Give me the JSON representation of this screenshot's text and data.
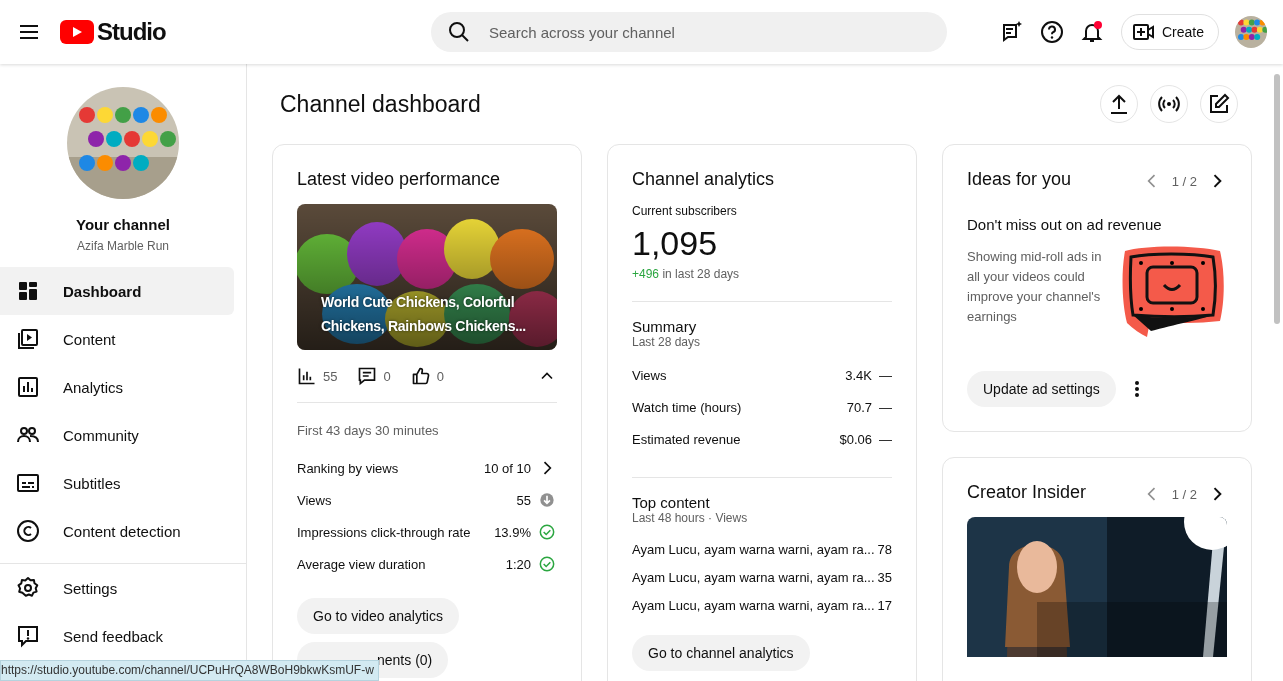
{
  "header": {
    "logo_text": "Studio",
    "search": {
      "placeholder": "Search across your channel"
    },
    "notifications_unread": true,
    "create_label": "Create"
  },
  "sidebar": {
    "channel_title": "Your channel",
    "channel_name": "Azifa Marble Run",
    "items": [
      {
        "label": "Dashboard",
        "selected": true
      },
      {
        "label": "Content",
        "selected": false
      },
      {
        "label": "Analytics",
        "selected": false
      },
      {
        "label": "Community",
        "selected": false
      },
      {
        "label": "Subtitles",
        "selected": false
      },
      {
        "label": "Content detection",
        "selected": false
      }
    ],
    "footer_items": [
      {
        "label": "Settings"
      },
      {
        "label": "Send feedback"
      }
    ]
  },
  "page_title": "Channel dashboard",
  "latest_video": {
    "title": "Latest video performance",
    "video_title": "World Cute Chickens, Colorful Chickens, Rainbows Chickens...",
    "stats": [
      {
        "value": "55"
      },
      {
        "value": "0"
      },
      {
        "value": "0"
      }
    ],
    "expanded": true,
    "period": "First 43 days 30 minutes",
    "metrics": [
      {
        "label": "Ranking by views",
        "value": "10 of 10",
        "kind": "next"
      },
      {
        "label": "Views",
        "value": "55",
        "kind": "below"
      },
      {
        "label": "Impressions click-through rate",
        "value": "13.9%",
        "kind": "good"
      },
      {
        "label": "Average view duration",
        "value": "1:20",
        "kind": "good"
      }
    ],
    "buttons": [
      "Go to video analytics",
      "nents (0)"
    ]
  },
  "channel_analytics": {
    "title": "Channel analytics",
    "subscribers_label": "Current subscribers",
    "subscribers": "1,095",
    "change": "+496",
    "change_suffix": "in last 28 days",
    "summary_title": "Summary",
    "summary_period": "Last 28 days",
    "summary": [
      {
        "label": "Views",
        "value": "3.4K",
        "trend": "—"
      },
      {
        "label": "Watch time (hours)",
        "value": "70.7",
        "trend": "—"
      },
      {
        "label": "Estimated revenue",
        "value": "$0.06",
        "trend": "—"
      }
    ],
    "top_title": "Top content",
    "top_period": "Last 48 hours · Views",
    "top": [
      {
        "title": "Ayam Lucu, ayam warna warni, ayam ra...",
        "views": "78"
      },
      {
        "title": "Ayam Lucu, ayam warna warni, ayam ra...",
        "views": "35"
      },
      {
        "title": "Ayam Lucu, ayam warna warni, ayam ra...",
        "views": "17"
      }
    ],
    "button": "Go to channel analytics"
  },
  "ideas": {
    "title": "Ideas for you",
    "pager": "1 / 2",
    "has_previous": false,
    "heading": "Don't miss out on ad revenue",
    "body": "Showing mid-roll ads in all your videos could improve your channel's earnings",
    "button": "Update ad settings"
  },
  "creator_insider": {
    "title": "Creator Insider",
    "pager": "1 / 2",
    "has_previous": false
  },
  "status_url": "https://studio.youtube.com/channel/UCPuHrQA8WBoH9bkwKsmUF-w"
}
